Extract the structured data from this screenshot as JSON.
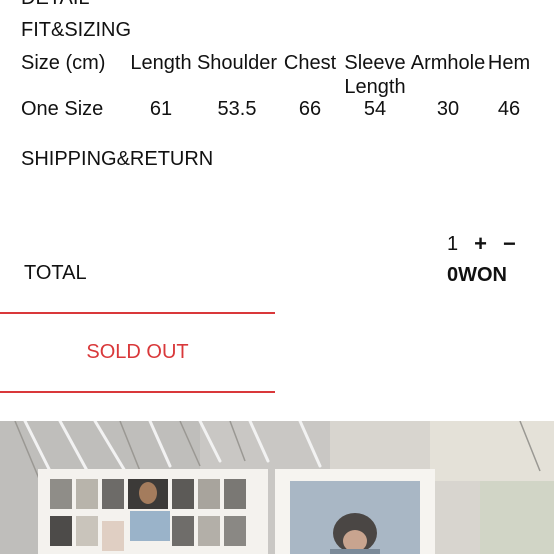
{
  "sections": {
    "detail_label_cut": "DETAIL",
    "fit_sizing_title": "FIT&SIZING",
    "shipping_return_title": "SHIPPING&RETURN"
  },
  "size_table": {
    "headers": {
      "size": "Size (cm)",
      "length": "Length",
      "shoulder": "Shoulder",
      "chest": "Chest",
      "sleeve_line1": "Sleeve",
      "sleeve_line2": "Length",
      "armhole": "Armhole",
      "hem": "Hem"
    },
    "row": {
      "size": "One Size",
      "length": "61",
      "shoulder": "53.5",
      "chest": "66",
      "sleeve": "54",
      "armhole": "30",
      "hem": "46"
    }
  },
  "quantity": {
    "value": "1",
    "plus_symbol": "+",
    "minus_symbol": "−"
  },
  "total": {
    "label": "TOTAL",
    "value": "0WON"
  },
  "sold_out_label": "SOLD OUT",
  "colors": {
    "accent_red": "#d9383a",
    "text": "#111111",
    "background": "#ffffff"
  }
}
